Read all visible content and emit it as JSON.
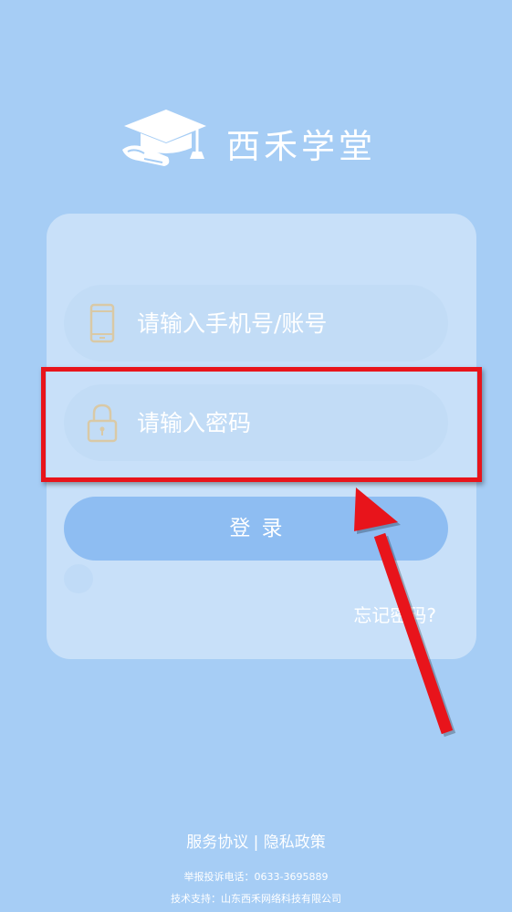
{
  "brand": {
    "name": "西禾学堂"
  },
  "form": {
    "account_placeholder": "请输入手机号/账号",
    "password_placeholder": "请输入密码",
    "login_label": "登录",
    "forgot_label": "忘记密码?"
  },
  "footer": {
    "terms_label": "服务协议",
    "separator": "|",
    "privacy_label": "隐私政策",
    "report_phone": "举报投诉电话：0633-3695889",
    "tech_support": "技术支持：山东西禾网络科技有限公司"
  },
  "icons": {
    "logo": "graduation-cap-icon",
    "account": "phone-icon",
    "password": "lock-icon"
  },
  "colors": {
    "background": "#a6cdf5",
    "button": "#8ebdf2",
    "highlight": "#e8141b"
  }
}
